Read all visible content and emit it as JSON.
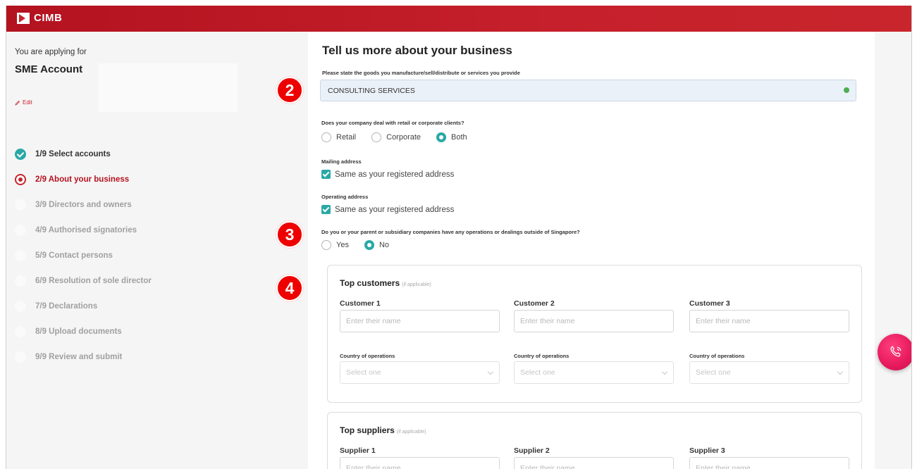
{
  "header": {
    "brand": "CIMB",
    "brand_color": "#c8252d"
  },
  "sidebar": {
    "applying_label": "You are applying for",
    "account_name": "SME Account",
    "edit_label": "Edit",
    "steps": [
      {
        "label": "1/9 Select accounts",
        "state": "done"
      },
      {
        "label": "2/9 About your business",
        "state": "active"
      },
      {
        "label": "3/9 Directors and owners",
        "state": "pending"
      },
      {
        "label": "4/9 Authorised signatories",
        "state": "pending"
      },
      {
        "label": "5/9 Contact persons",
        "state": "pending"
      },
      {
        "label": "6/9 Resolution of sole director",
        "state": "pending"
      },
      {
        "label": "7/9 Declarations",
        "state": "pending"
      },
      {
        "label": "8/9 Upload documents",
        "state": "pending"
      },
      {
        "label": "9/9 Review and submit",
        "state": "pending"
      }
    ]
  },
  "main": {
    "title": "Tell us more about your business",
    "goods_label": "Please state the goods you manufacture/sell/distribute or services you provide",
    "goods_value": "CONSULTING SERVICES",
    "clients_question": "Does your company deal with retail or corporate clients?",
    "client_options": [
      "Retail",
      "Corporate",
      "Both"
    ],
    "client_selected": "Both",
    "mailing_label": "Mailing address",
    "mailing_checkbox": "Same as your registered address",
    "operating_label": "Operating address",
    "operating_checkbox": "Same as your registered address",
    "overseas_question": "Do you or your parent or subsidiary companies have any operations or dealings outside of Singapore?",
    "overseas_options": [
      "Yes",
      "No"
    ],
    "overseas_selected": "No",
    "customers": {
      "title": "Top customers",
      "hint": "(if applicable)",
      "columns": [
        "Customer 1",
        "Customer 2",
        "Customer 3"
      ],
      "name_placeholder": "Enter their name",
      "country_label": "Country of operations",
      "country_placeholder": "Select one"
    },
    "suppliers": {
      "title": "Top suppliers",
      "hint": "(if applicable)",
      "columns": [
        "Supplier 1",
        "Supplier 2",
        "Supplier 3"
      ],
      "name_placeholder": "Enter their name"
    }
  },
  "badges": [
    "2",
    "3",
    "4"
  ],
  "accent_color": "#2aa8a5",
  "call_icon": "phone-call-icon"
}
